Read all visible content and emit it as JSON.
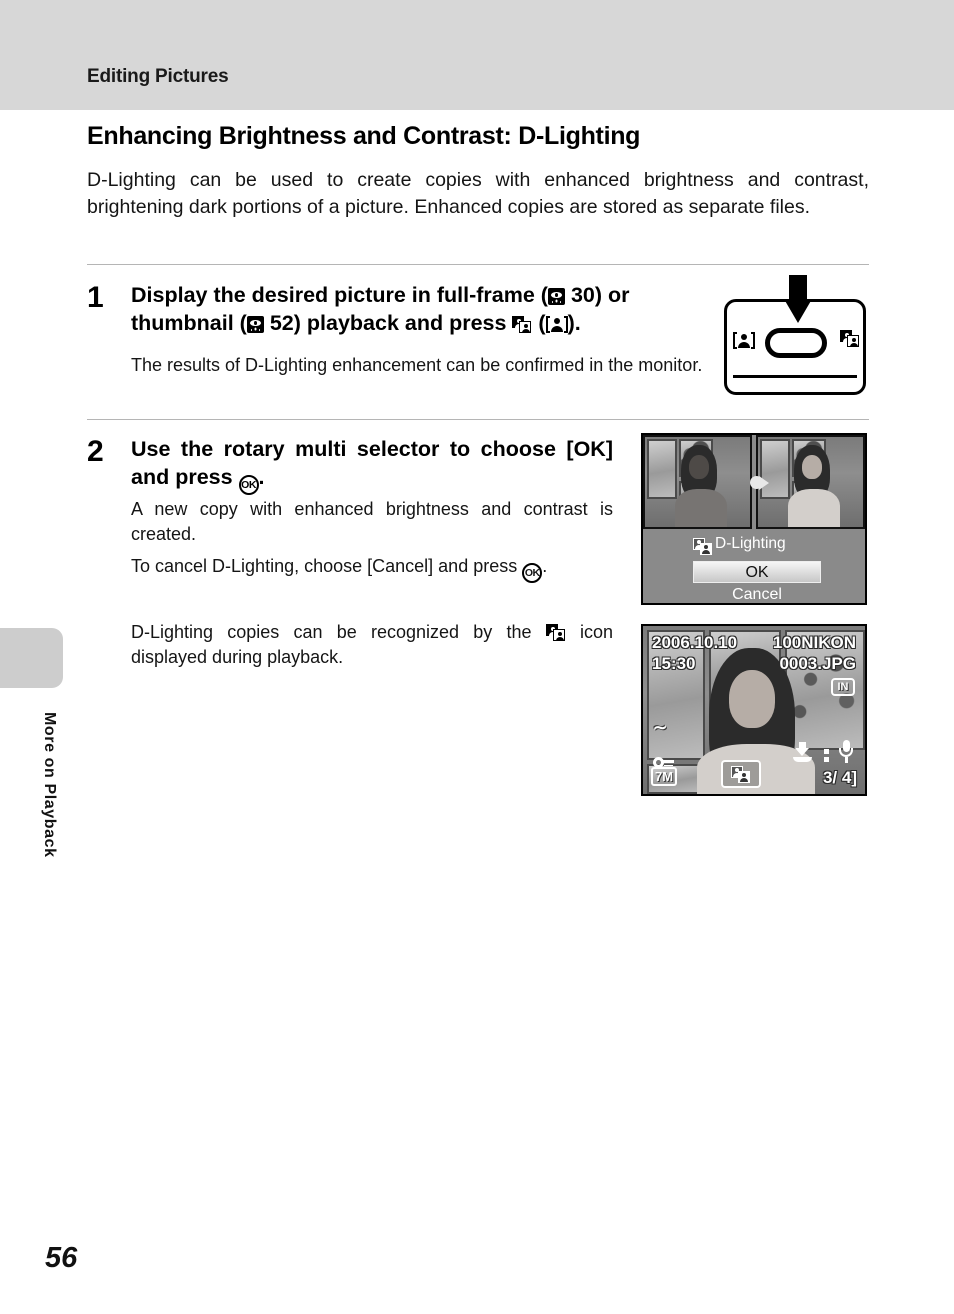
{
  "header": {
    "running_head": "Editing Pictures"
  },
  "side_index": {
    "label": "More on Playback"
  },
  "page": {
    "number": "56"
  },
  "section": {
    "title": "Enhancing Brightness and Contrast: D-Lighting",
    "intro": "D-Lighting can be used to create copies with enhanced brightness and contrast, brightening dark portions of a picture. Enhanced copies are stored as separate files."
  },
  "steps": [
    {
      "number": "1",
      "head_part1": "Display the desired picture in full-frame (",
      "head_ref1": "30",
      "head_part2": ") or thumbnail (",
      "head_ref2": "52",
      "head_part3": ") playback and press ",
      "head_part4": " (",
      "head_part5": ").",
      "body": "The results of D-Lighting enhancement can be confirmed in the monitor."
    },
    {
      "number": "2",
      "head_part1": "Use the rotary multi selector to choose [OK] and press ",
      "head_part2": ".",
      "body1": "A new copy with enhanced brightness and contrast is created.",
      "body2_part1": "To cancel D-Lighting, choose [Cancel] and press ",
      "body2_part2": ".",
      "body3_part1": "D-Lighting copies can be recognized by the ",
      "body3_part2": " icon displayed during playback."
    }
  ],
  "camera_figure": {
    "left_icon_name": "portrait-mode-icon",
    "right_icon_name": "d-lighting-icon",
    "arrow_name": "press-down-arrow"
  },
  "dlighting_screen": {
    "menu_title": "D-Lighting",
    "options": [
      {
        "label": "OK",
        "selected": true
      },
      {
        "label": "Cancel",
        "selected": false
      }
    ]
  },
  "playback_screen": {
    "date": "2006.10.10",
    "time": "15:30",
    "folder": "100NIKON",
    "filename": "0003.JPG",
    "memory_badge": "IN",
    "image_size_badge": "7M",
    "frame_counter": "3/   4]",
    "icons": [
      "battery-icon",
      "protect-key-icon",
      "d-lighting-badge-icon",
      "save-icon",
      "microphone-icon"
    ]
  },
  "colors": {
    "header_band": "#d7d7d7",
    "side_tab": "#cdcdcd",
    "rule": "#b5b5b5",
    "text": "#000000",
    "menu_background": "#8a8a8a"
  }
}
